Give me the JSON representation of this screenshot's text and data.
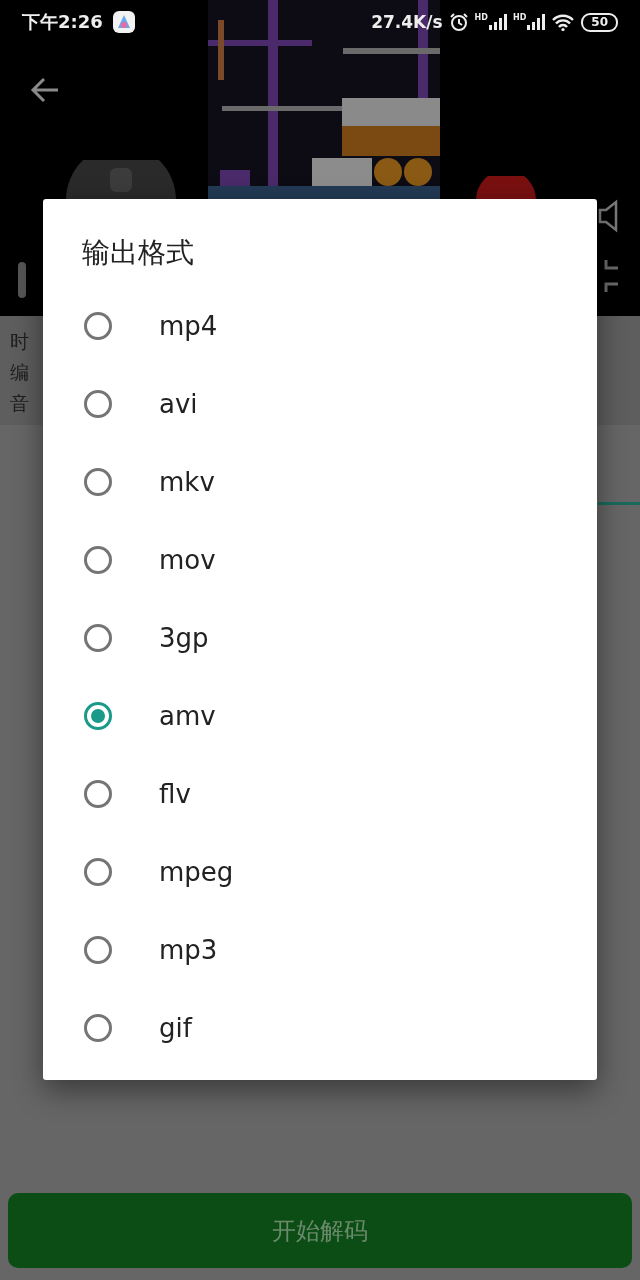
{
  "status_bar": {
    "time": "下午2:26",
    "net_speed": "27.4K/s",
    "signals": [
      {
        "label": "HD"
      },
      {
        "label": "HD"
      }
    ],
    "battery": "50"
  },
  "info_labels": [
    "时",
    "编",
    "音"
  ],
  "dialog": {
    "title": "输出格式",
    "options": [
      {
        "label": "mp4",
        "selected": false
      },
      {
        "label": "avi",
        "selected": false
      },
      {
        "label": "mkv",
        "selected": false
      },
      {
        "label": "mov",
        "selected": false
      },
      {
        "label": "3gp",
        "selected": false
      },
      {
        "label": "amv",
        "selected": true
      },
      {
        "label": "flv",
        "selected": false
      },
      {
        "label": "mpeg",
        "selected": false
      },
      {
        "label": "mp3",
        "selected": false
      },
      {
        "label": "gif",
        "selected": false
      }
    ]
  },
  "start_button": {
    "label": "开始解码"
  }
}
